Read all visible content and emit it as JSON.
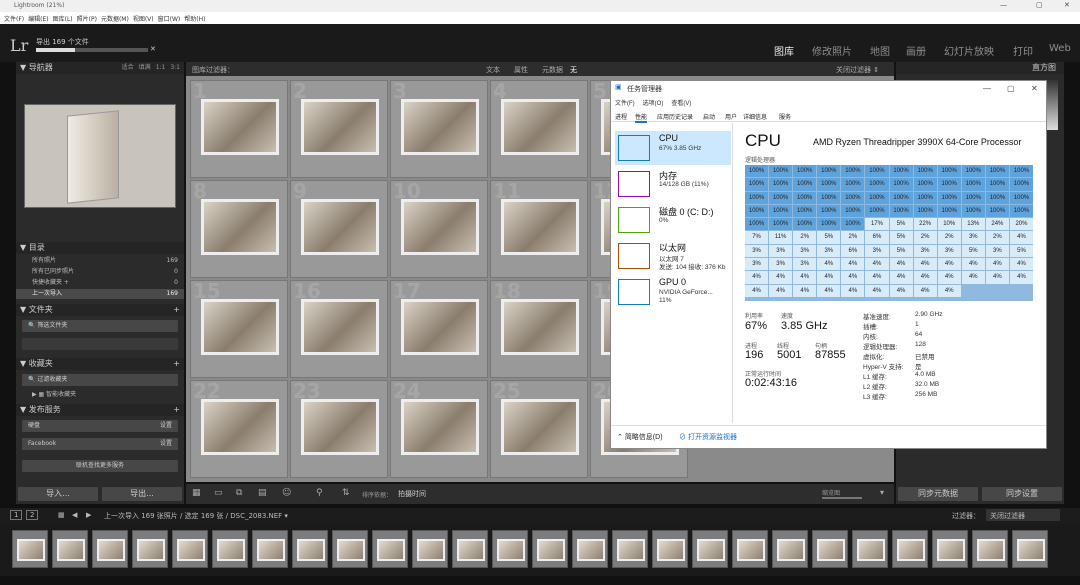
{
  "window": {
    "title": "Lightroom (21%)",
    "min": "—",
    "max": "▢",
    "close": "✕"
  },
  "menubar": [
    "文件(F)",
    "编辑(E)",
    "图库(L)",
    "照片(P)",
    "元数据(M)",
    "视图(V)",
    "窗口(W)",
    "帮助(H)"
  ],
  "app": {
    "logo": "Lr",
    "progress_label": "导出 169 个文件",
    "progress_fraction": 0.35
  },
  "modules": [
    "图库",
    "修改照片",
    "地图",
    "画册",
    "幻灯片放映",
    "打印",
    "Web"
  ],
  "navigator": {
    "title": "导航器",
    "zoom": [
      "适合",
      "填满",
      "1:1",
      "3:1"
    ]
  },
  "catalog": {
    "title": "目录",
    "items": [
      {
        "label": "所有照片",
        "count": "169"
      },
      {
        "label": "所有已同步照片",
        "count": "0"
      },
      {
        "label": "快捷收藏夹 +",
        "count": "0"
      },
      {
        "label": "上一次导入",
        "count": "169"
      }
    ]
  },
  "folders": {
    "title": "文件夹",
    "filter_placeholder": "筛选文件夹"
  },
  "collections": {
    "title": "收藏夹",
    "filter_placeholder": "过滤收藏夹",
    "smart": "智能收藏夹"
  },
  "publish": {
    "title": "发布服务",
    "items": [
      {
        "label": "硬盘",
        "action": "设置"
      },
      {
        "label": "Facebook",
        "action": "设置"
      }
    ],
    "find_more": "联机查找更多服务"
  },
  "left_buttons": {
    "import": "导入...",
    "export": "导出..."
  },
  "grid_header": {
    "title": "图库过滤器：",
    "filters": [
      "文本",
      "属性",
      "元数据",
      "无"
    ],
    "filter_off": "关闭过滤器 ⇕"
  },
  "grid_cells": [
    "1",
    "2",
    "3",
    "4",
    "5",
    "8",
    "9",
    "10",
    "11",
    "12",
    "15",
    "16",
    "17",
    "18",
    "19",
    "22",
    "23",
    "24",
    "25",
    "26"
  ],
  "toolbar": {
    "sort_label": "排序依据：",
    "sort_value": "拍摄时间",
    "thumbnails": "缩览图"
  },
  "right_panel": {
    "histogram": "直方图",
    "sync_metadata": "同步元数据",
    "sync_settings": "同步设置"
  },
  "filmstrip_bar": {
    "pages": [
      "1",
      "2"
    ],
    "path": "上一次导入 169 张照片 / 选定 169 张 / DSC_2083.NEF ▾",
    "filter_label": "过滤器：",
    "filter_value": "关闭过滤器"
  },
  "filmstrip_count": 26,
  "task_manager": {
    "title": "任务管理器",
    "menu": [
      "文件(F)",
      "选项(O)",
      "查看(V)"
    ],
    "tabs": [
      "进程",
      "性能",
      "应用历史记录",
      "启动",
      "用户",
      "详细信息",
      "服务"
    ],
    "side": [
      {
        "name": "CPU",
        "l2": "67% 3.85 GHz",
        "l3": "",
        "color": "#117dbb"
      },
      {
        "name": "内存",
        "l2": "14/128 GB (11%)",
        "l3": "",
        "color": "#8b12ae"
      },
      {
        "name": "磁盘 0 (C: D:)",
        "l2": "0%",
        "l3": "",
        "color": "#4da60c"
      },
      {
        "name": "以太网",
        "l2": "以太网 7",
        "l3": "发送: 104 接收: 376 Kb",
        "color": "#a74f01"
      },
      {
        "name": "GPU 0",
        "l2": "NVIDIA GeForce...",
        "l3": "11%",
        "color": "#117dbb"
      }
    ],
    "header": {
      "cpu": "CPU",
      "model": "AMD Ryzen Threadripper 3990X 64-Core Processor",
      "logical": "逻辑处理器"
    },
    "cpu_cells": [
      "100%",
      "100%",
      "100%",
      "100%",
      "100%",
      "100%",
      "100%",
      "100%",
      "100%",
      "100%",
      "100%",
      "100%",
      "100%",
      "100%",
      "100%",
      "100%",
      "100%",
      "100%",
      "100%",
      "100%",
      "100%",
      "100%",
      "100%",
      "100%",
      "100%",
      "100%",
      "100%",
      "100%",
      "100%",
      "100%",
      "100%",
      "100%",
      "100%",
      "100%",
      "100%",
      "100%",
      "100%",
      "100%",
      "100%",
      "100%",
      "100%",
      "100%",
      "100%",
      "100%",
      "100%",
      "100%",
      "100%",
      "100%",
      "100%",
      "100%",
      "100%",
      "100%",
      "100%",
      "17%",
      "5%",
      "22%",
      "10%",
      "13%",
      "24%",
      "20%",
      "7%",
      "11%",
      "2%",
      "5%",
      "2%",
      "6%",
      "5%",
      "2%",
      "2%",
      "3%",
      "2%",
      "4%",
      "3%",
      "3%",
      "3%",
      "3%",
      "6%",
      "3%",
      "5%",
      "3%",
      "3%",
      "5%",
      "3%",
      "5%",
      "3%",
      "3%",
      "3%",
      "4%",
      "4%",
      "4%",
      "4%",
      "4%",
      "4%",
      "4%",
      "4%",
      "4%",
      "4%",
      "4%",
      "4%",
      "4%",
      "4%",
      "4%",
      "4%",
      "4%",
      "4%",
      "4%",
      "4%",
      "4%",
      "4%",
      "4%",
      "4%",
      "4%",
      "4%",
      "4%",
      "4%",
      "4%",
      "4%"
    ],
    "stats": {
      "util_label": "利用率",
      "util": "67%",
      "speed_label": "速度",
      "speed": "3.85 GHz",
      "proc_label": "进程",
      "proc": "196",
      "thread_label": "线程",
      "thread": "5001",
      "handle_label": "句柄",
      "handle": "87855",
      "uptime_label": "正常运行时间",
      "uptime": "0:02:43:16"
    },
    "kv": [
      {
        "k": "基准速度:",
        "v": "2.90 GHz"
      },
      {
        "k": "插槽:",
        "v": "1"
      },
      {
        "k": "内核:",
        "v": "64"
      },
      {
        "k": "逻辑处理器:",
        "v": "128"
      },
      {
        "k": "虚拟化:",
        "v": "已禁用"
      },
      {
        "k": "Hyper-V 支持:",
        "v": "是"
      },
      {
        "k": "L1 缓存:",
        "v": "4.0 MB"
      },
      {
        "k": "L2 缓存:",
        "v": "32.0 MB"
      },
      {
        "k": "L3 缓存:",
        "v": "256 MB"
      }
    ],
    "footer": {
      "brief": "简略信息(D)",
      "monitor": "打开资源监视器"
    }
  }
}
